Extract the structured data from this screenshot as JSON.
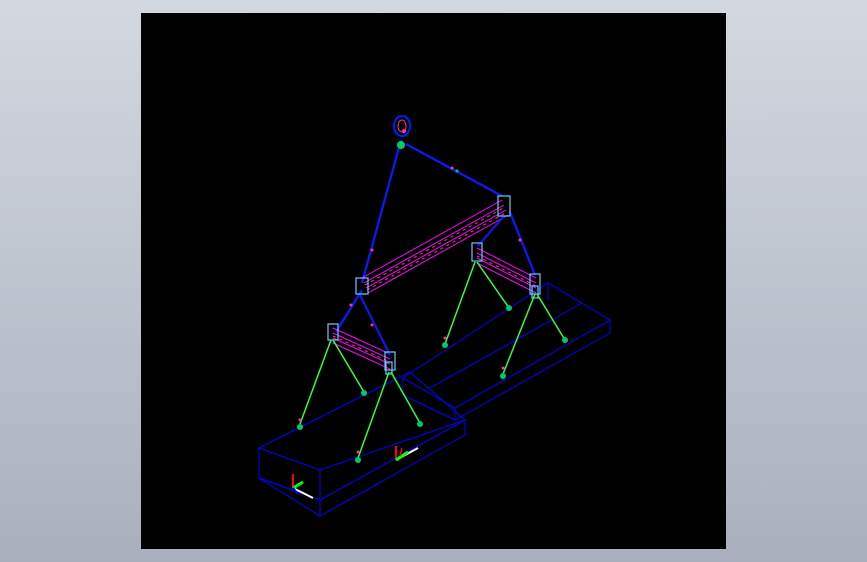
{
  "drawing": {
    "background": "#000000",
    "page_background_top": "#d3d8e0",
    "page_background_bottom": "#a9b0bd",
    "colors": {
      "outline": "#0000ff",
      "chain": "#0a1aff",
      "spreader_lines": "#ff00ff",
      "spreader_accent": "#ff3399",
      "lugs": "#66ccff",
      "slings": "#33ff33",
      "hooks": "#00cc66",
      "triad_x": "#ff0000",
      "triad_y": "#00ff00",
      "triad_z": "#0000ff",
      "triad_base": "#ffffff"
    },
    "icons": [
      "crane-hook-icon",
      "axis-triad-icon"
    ]
  }
}
